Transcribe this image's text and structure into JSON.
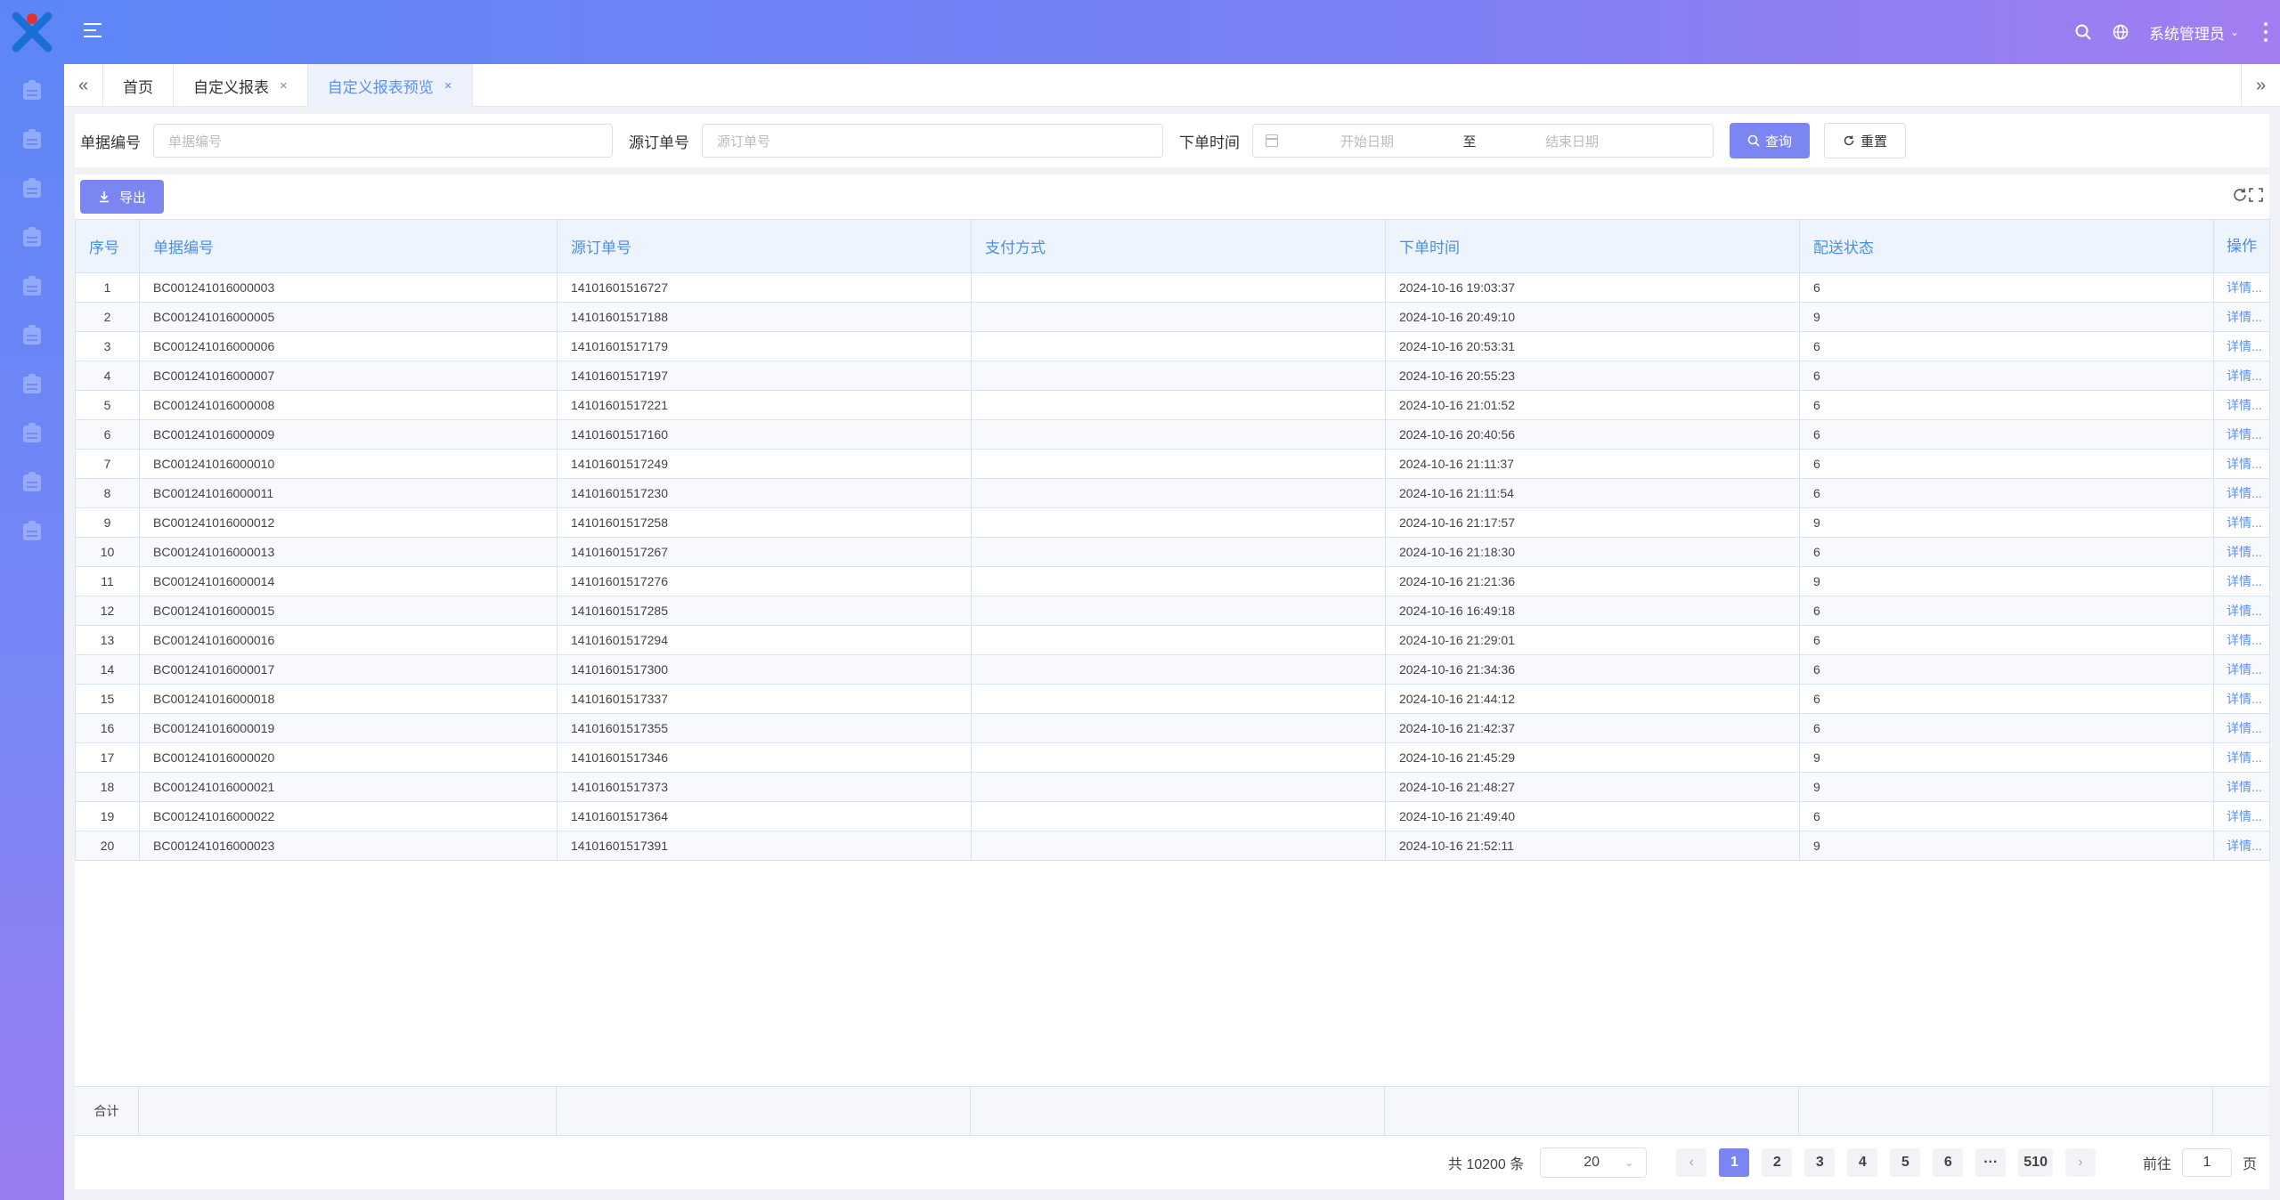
{
  "header": {
    "user_label": "系统管理员",
    "user_chevron": "⌄"
  },
  "sidebar": {
    "icon_count": 10
  },
  "tabs": {
    "left_arrow": "«",
    "right_arrow": "»",
    "items": [
      {
        "label": "首页",
        "closable": false,
        "active": false
      },
      {
        "label": "自定义报表",
        "closable": true,
        "active": false
      },
      {
        "label": "自定义报表预览",
        "closable": true,
        "active": true
      }
    ],
    "close_glyph": "×"
  },
  "search": {
    "order_no_label": "单据编号",
    "order_no_placeholder": "单据编号",
    "source_no_label": "源订单号",
    "source_no_placeholder": "源订单号",
    "time_label": "下单时间",
    "start_placeholder": "开始日期",
    "range_separator": "至",
    "end_placeholder": "结束日期",
    "query_label": "查询",
    "reset_label": "重置"
  },
  "toolbar": {
    "export_label": "导出"
  },
  "table": {
    "columns": [
      "序号",
      "单据编号",
      "源订单号",
      "支付方式",
      "下单时间",
      "配送状态",
      "操作"
    ],
    "detail_label": "详情...",
    "rows": [
      [
        "1",
        "BC001241016000003",
        "14101601516727",
        "",
        "2024-10-16 19:03:37",
        "6"
      ],
      [
        "2",
        "BC001241016000005",
        "14101601517188",
        "",
        "2024-10-16 20:49:10",
        "9"
      ],
      [
        "3",
        "BC001241016000006",
        "14101601517179",
        "",
        "2024-10-16 20:53:31",
        "6"
      ],
      [
        "4",
        "BC001241016000007",
        "14101601517197",
        "",
        "2024-10-16 20:55:23",
        "6"
      ],
      [
        "5",
        "BC001241016000008",
        "14101601517221",
        "",
        "2024-10-16 21:01:52",
        "6"
      ],
      [
        "6",
        "BC001241016000009",
        "14101601517160",
        "",
        "2024-10-16 20:40:56",
        "6"
      ],
      [
        "7",
        "BC001241016000010",
        "14101601517249",
        "",
        "2024-10-16 21:11:37",
        "6"
      ],
      [
        "8",
        "BC001241016000011",
        "14101601517230",
        "",
        "2024-10-16 21:11:54",
        "6"
      ],
      [
        "9",
        "BC001241016000012",
        "14101601517258",
        "",
        "2024-10-16 21:17:57",
        "9"
      ],
      [
        "10",
        "BC001241016000013",
        "14101601517267",
        "",
        "2024-10-16 21:18:30",
        "6"
      ],
      [
        "11",
        "BC001241016000014",
        "14101601517276",
        "",
        "2024-10-16 21:21:36",
        "9"
      ],
      [
        "12",
        "BC001241016000015",
        "14101601517285",
        "",
        "2024-10-16 16:49:18",
        "6"
      ],
      [
        "13",
        "BC001241016000016",
        "14101601517294",
        "",
        "2024-10-16 21:29:01",
        "6"
      ],
      [
        "14",
        "BC001241016000017",
        "14101601517300",
        "",
        "2024-10-16 21:34:36",
        "6"
      ],
      [
        "15",
        "BC001241016000018",
        "14101601517337",
        "",
        "2024-10-16 21:44:12",
        "6"
      ],
      [
        "16",
        "BC001241016000019",
        "14101601517355",
        "",
        "2024-10-16 21:42:37",
        "6"
      ],
      [
        "17",
        "BC001241016000020",
        "14101601517346",
        "",
        "2024-10-16 21:45:29",
        "9"
      ],
      [
        "18",
        "BC001241016000021",
        "14101601517373",
        "",
        "2024-10-16 21:48:27",
        "9"
      ],
      [
        "19",
        "BC001241016000022",
        "14101601517364",
        "",
        "2024-10-16 21:49:40",
        "6"
      ],
      [
        "20",
        "BC001241016000023",
        "14101601517391",
        "",
        "2024-10-16 21:52:11",
        "9"
      ]
    ],
    "summary_label": "合计"
  },
  "pagination": {
    "total_text": "共 10200 条",
    "page_size": "20",
    "size_chevron": "⌄",
    "pages": [
      "1",
      "2",
      "3",
      "4",
      "5",
      "6",
      "···",
      "510"
    ],
    "active_page": "1",
    "prev_glyph": "‹",
    "next_glyph": "›",
    "goto_label": "前往",
    "goto_value": "1",
    "goto_suffix": "页"
  },
  "colors": {
    "accent": "#7b86f3",
    "link": "#5b8ff9",
    "header_text": "#4a8fe7"
  }
}
